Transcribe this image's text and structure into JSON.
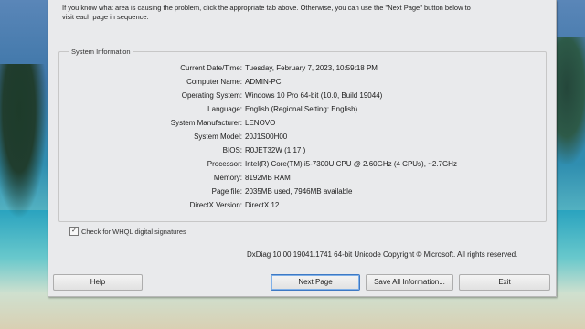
{
  "intro": {
    "line1": "If you know what area is causing the problem, click the appropriate tab above.  Otherwise, you can use the \"Next Page\" button below to",
    "line2": "visit each page in sequence."
  },
  "system_info": {
    "title": "System Information",
    "rows": [
      {
        "label": "Current Date/Time:",
        "value": "Tuesday, February 7, 2023, 10:59:18 PM"
      },
      {
        "label": "Computer Name:",
        "value": "ADMIN-PC"
      },
      {
        "label": "Operating System:",
        "value": "Windows 10 Pro 64-bit (10.0, Build 19044)"
      },
      {
        "label": "Language:",
        "value": "English (Regional Setting: English)"
      },
      {
        "label": "System Manufacturer:",
        "value": "LENOVO"
      },
      {
        "label": "System Model:",
        "value": "20J1S00H00"
      },
      {
        "label": "BIOS:",
        "value": "R0JET32W (1.17 )"
      },
      {
        "label": "Processor:",
        "value": "Intel(R) Core(TM) i5-7300U CPU @ 2.60GHz (4 CPUs), ~2.7GHz"
      },
      {
        "label": "Memory:",
        "value": "8192MB RAM"
      },
      {
        "label": "Page file:",
        "value": "2035MB used, 7946MB available"
      },
      {
        "label": "DirectX Version:",
        "value": "DirectX 12"
      }
    ]
  },
  "whql": {
    "label": "Check for WHQL digital signatures",
    "checked_mark": "✓"
  },
  "copyright": "DxDiag 10.00.19041.1741 64-bit Unicode  Copyright © Microsoft. All rights reserved.",
  "buttons": {
    "help": "Help",
    "next_page": "Next Page",
    "save_all": "Save All Information...",
    "exit": "Exit"
  }
}
